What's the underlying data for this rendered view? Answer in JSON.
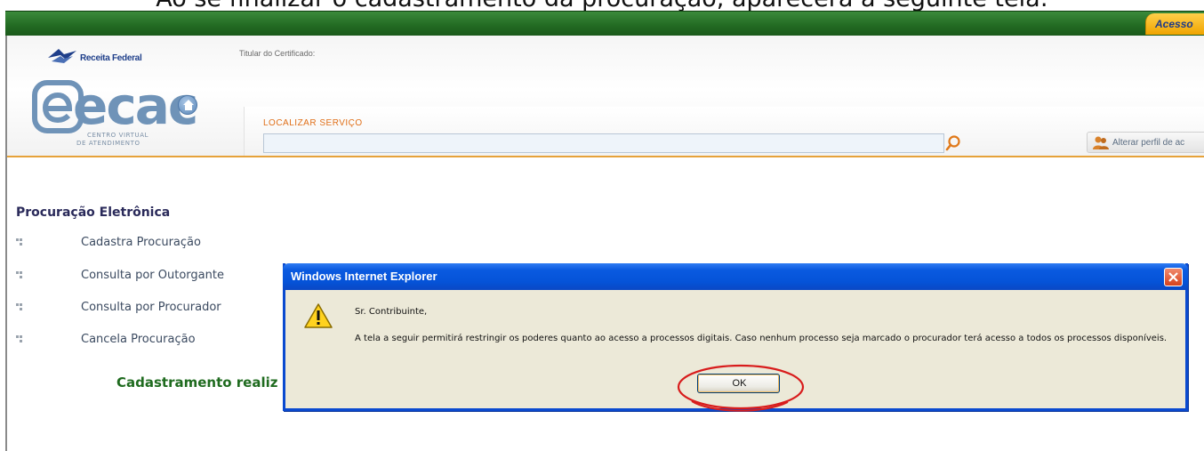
{
  "caption": "Ao se finalizar o cadastramento da procuração, aparecerá a seguinte tela:",
  "topbar": {
    "tab_label": "Acesso"
  },
  "header": {
    "rf_logo_text": "Receita Federal",
    "titular_label": "Titular do Certificado:",
    "ecac_word": "ecac",
    "ecac_sub1": "CENTRO VIRTUAL",
    "ecac_sub2": "DE ATENDIMENTO",
    "search_label": "LOCALIZAR SERVIÇO",
    "search_value": "",
    "perfil_label": "Alterar perfil de ac"
  },
  "content": {
    "title": "Procuração Eletrônica",
    "menu": [
      {
        "label": "Cadastra Procuração"
      },
      {
        "label": "Consulta por Outorgante"
      },
      {
        "label": "Consulta por Procurador"
      },
      {
        "label": "Cancela Procuração"
      }
    ],
    "status": "Cadastramento realiz"
  },
  "dialog": {
    "title": "Windows Internet Explorer",
    "line1": "Sr. Contribuinte,",
    "line2": "A tela a seguir permitirá restringir os poderes quanto ao acesso a processos digitais. Caso nenhum processo seja marcado o procurador terá acesso a todos os processos disponíveis.",
    "ok_label": "OK"
  },
  "colors": {
    "topbar_green": "#226a22",
    "accent_orange": "#e6a23a",
    "dialog_blue": "#0a5ae0",
    "highlight_red": "#d81c1c"
  }
}
